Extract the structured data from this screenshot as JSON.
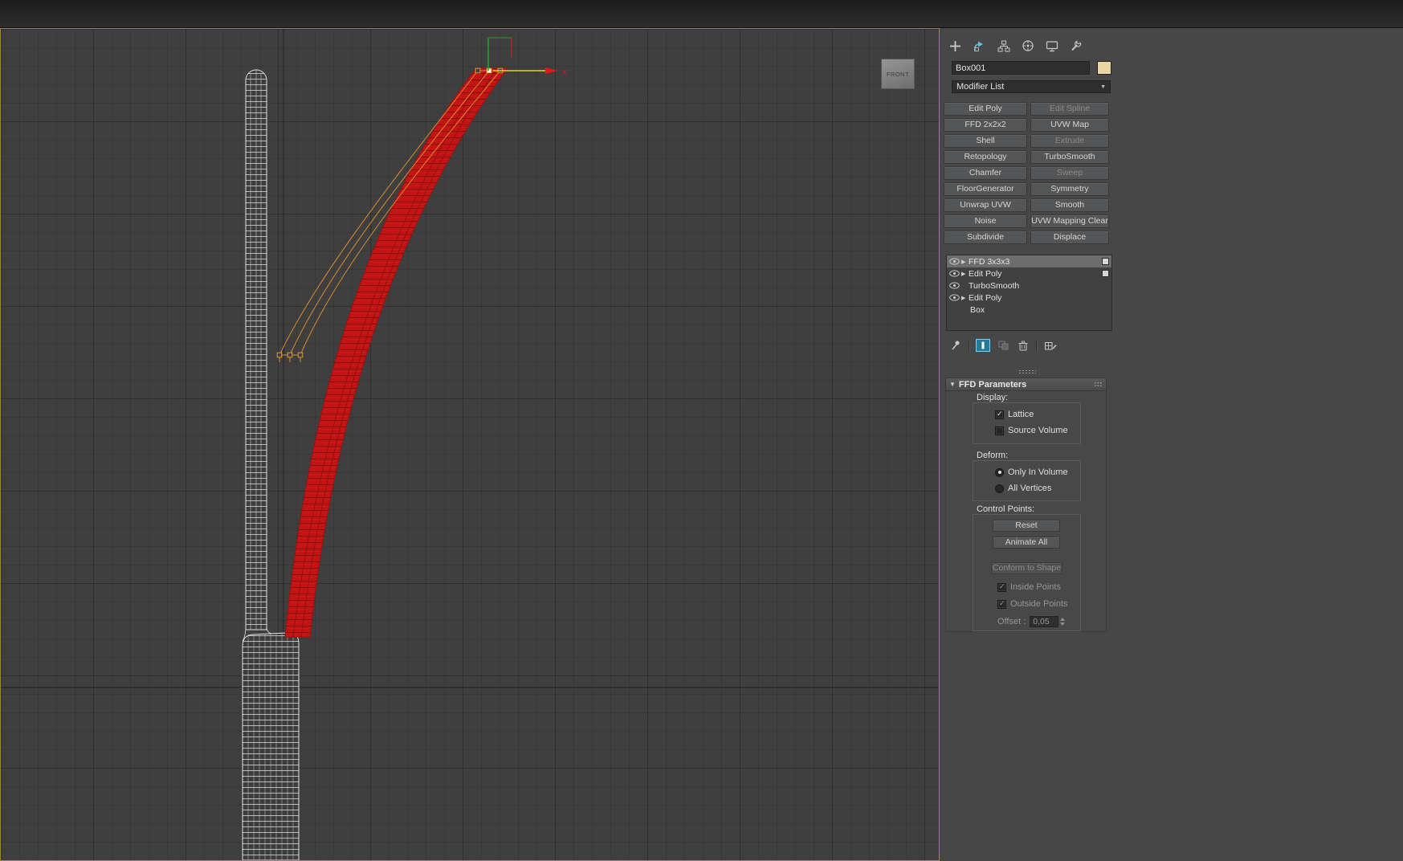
{
  "viewport": {
    "viewcube_label": "FRONT",
    "axis_x_label": "x",
    "colors": {
      "background": "#3f3f3f",
      "active_viewport_border": "#a28b2b",
      "selected_object_fill": "#c41515",
      "selected_object_wire": "#860d0d",
      "ffd_lattice": "#d88d2c",
      "wireframe_object": "#e2e2e2",
      "axis_x": "#e01818",
      "axis_y": "#25a325",
      "axis_active": "#e6d41f"
    }
  },
  "panel": {
    "tabs": [
      {
        "name": "create"
      },
      {
        "name": "modify",
        "active": true
      },
      {
        "name": "hierarchy"
      },
      {
        "name": "motion"
      },
      {
        "name": "display"
      },
      {
        "name": "utilities"
      }
    ],
    "object_name": "Box001",
    "object_color": "#e9d6a4",
    "modifier_list_label": "Modifier List",
    "buttons": [
      {
        "label": "Edit Poly",
        "enabled": true
      },
      {
        "label": "Edit Spline",
        "enabled": false
      },
      {
        "label": "FFD 2x2x2",
        "enabled": true
      },
      {
        "label": "UVW Map",
        "enabled": true
      },
      {
        "label": "Shell",
        "enabled": true
      },
      {
        "label": "Extrude",
        "enabled": false
      },
      {
        "label": "Retopology",
        "enabled": true
      },
      {
        "label": "TurboSmooth",
        "enabled": true
      },
      {
        "label": "Chamfer",
        "enabled": true
      },
      {
        "label": "Sweep",
        "enabled": false
      },
      {
        "label": "FloorGenerator",
        "enabled": true
      },
      {
        "label": "Symmetry",
        "enabled": true
      },
      {
        "label": "Unwrap UVW",
        "enabled": true
      },
      {
        "label": "Smooth",
        "enabled": true
      },
      {
        "label": "Noise",
        "enabled": true
      },
      {
        "label": "UVW Mapping Clear",
        "enabled": true
      },
      {
        "label": "Subdivide",
        "enabled": true
      },
      {
        "label": "Displace",
        "enabled": true
      }
    ],
    "stack": [
      {
        "label": "FFD 3x3x3",
        "selected": true,
        "eye": true,
        "expandable": true,
        "badge": true
      },
      {
        "label": "Edit Poly",
        "eye": true,
        "expandable": true,
        "badge": true
      },
      {
        "label": "TurboSmooth",
        "eye": true,
        "expandable": false,
        "badge": false
      },
      {
        "label": "Edit Poly",
        "eye": true,
        "expandable": true,
        "badge": false
      },
      {
        "label": "Box",
        "indented": true
      }
    ],
    "rollout": {
      "title": "FFD Parameters",
      "display": {
        "label": "Display:",
        "lattice": "Lattice",
        "lattice_checked": true,
        "source_volume": "Source Volume",
        "source_volume_checked": false
      },
      "deform": {
        "label": "Deform:",
        "only_in_volume": "Only In Volume",
        "only_in_volume_selected": true,
        "all_vertices": "All Vertices",
        "all_vertices_selected": false
      },
      "control_points": {
        "label": "Control Points:",
        "reset": "Reset",
        "animate_all": "Animate All",
        "conform": "Conform to Shape",
        "conform_enabled": false,
        "inside_points": "Inside Points",
        "inside_points_checked": true,
        "outside_points": "Outside Points",
        "outside_points_checked": true,
        "offset_label": "Offset :",
        "offset_value": "0,05"
      }
    }
  }
}
